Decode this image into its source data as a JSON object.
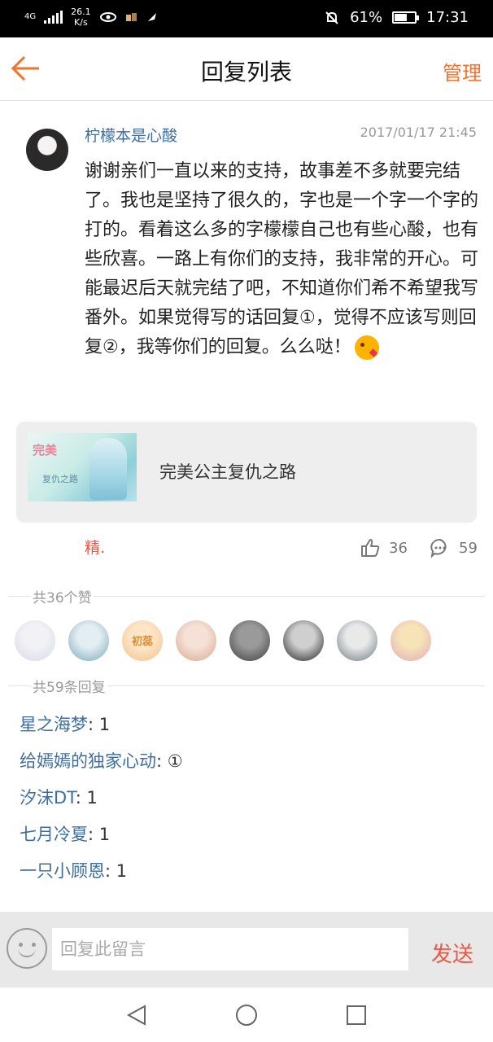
{
  "status_bar": {
    "network": "4G",
    "speed": "26.1",
    "speed_unit": "K/s",
    "battery_percent": "61%",
    "battery_level": 0.61,
    "time": "17:31"
  },
  "header": {
    "title": "回复列表",
    "manage_label": "管理"
  },
  "post": {
    "username": "柠檬本是心酸",
    "date": "2017/01/17 21:45",
    "body": "谢谢亲们一直以来的支持，故事差不多就要完结了。我也是坚持了很久的，字也是一个字一个字的打的。看着这么多的字檬檬自己也有些心酸，也有些欣喜。一路上有你们的支持，我非常的开心。可能最迟后天就完结了吧，不知道你们希不希望我写番外。如果觉得写的话回复①，觉得不应该写则回复②，我等你们的回复。么么哒！",
    "book": {
      "cover_text_1": "完美",
      "cover_text_2": "复仇之路",
      "title": "完美公主复仇之路"
    },
    "badge": "精.",
    "likes": "36",
    "comments": "59"
  },
  "likes_section": {
    "label": "共36个赞",
    "avatars": [
      {
        "color1": "#f2f2f6",
        "color2": "#d6d9e6",
        "text": ""
      },
      {
        "color1": "#e3eef2",
        "color2": "#7aa6b8",
        "text": ""
      },
      {
        "color1": "#fde6c8",
        "color2": "#f3c08a",
        "text": "初蕊"
      },
      {
        "color1": "#f6e1d6",
        "color2": "#d8a88e",
        "text": ""
      },
      {
        "color1": "#9a9a9a",
        "color2": "#3d3d3d",
        "text": ""
      },
      {
        "color1": "#cfcfcf",
        "color2": "#1f1f1f",
        "text": ""
      },
      {
        "color1": "#e9e9ea",
        "color2": "#6a7a7e",
        "text": ""
      },
      {
        "color1": "#f6e3b8",
        "color2": "#e3a8b7",
        "text": ""
      }
    ]
  },
  "replies_section": {
    "label": "共59条回复",
    "items": [
      {
        "name": "星之海梦",
        "text": ": 1"
      },
      {
        "name": "给嫣嫣的独家心动",
        "text": ": ①"
      },
      {
        "name": "汐沫DT",
        "text": ": 1"
      },
      {
        "name": "七月冷夏",
        "text": ": 1"
      },
      {
        "name": "一只小顾恩",
        "text": ": 1"
      }
    ]
  },
  "input": {
    "placeholder": "回复此留言",
    "send_label": "发送"
  },
  "colors": {
    "accent_orange": "#f0742e",
    "accent_red": "#e65a4a",
    "link_blue": "#3e6e9e"
  },
  "icons": [
    "back-arrow-icon",
    "like-icon",
    "comment-icon",
    "emoji-icon",
    "nav-back-icon",
    "nav-home-icon",
    "nav-recent-icon"
  ]
}
